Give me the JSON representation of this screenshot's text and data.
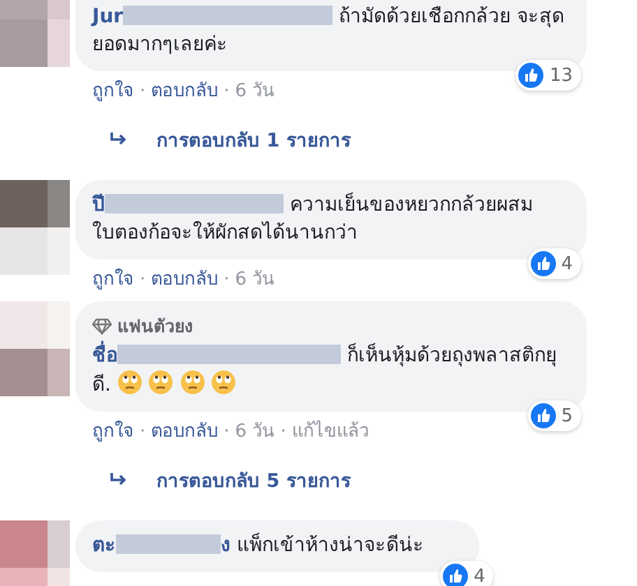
{
  "comments": [
    {
      "author": "Jur",
      "text": "ถ้ามัดด้วยเชือกกล้วย จะสุดยอดมากๆเลยค่ะ",
      "reactions": "13",
      "actions": [
        {
          "kind": "link",
          "text": "ถูกใจ"
        },
        {
          "kind": "sep",
          "text": "·"
        },
        {
          "kind": "link",
          "text": "ตอบกลับ"
        },
        {
          "kind": "sep",
          "text": "·"
        },
        {
          "kind": "meta",
          "text": "6 วัน"
        }
      ],
      "replies": "การตอบกลับ 1 รายการ"
    },
    {
      "author": "ปี",
      "text": "ความเย็นของหยวกกล้วยผสมใบตองก้อจะให้ผักสดได้นานกว่า",
      "reactions": "4",
      "actions": [
        {
          "kind": "link",
          "text": "ถูกใจ"
        },
        {
          "kind": "sep",
          "text": "·"
        },
        {
          "kind": "link",
          "text": "ตอบกลับ"
        },
        {
          "kind": "sep",
          "text": "·"
        },
        {
          "kind": "meta",
          "text": "6 วัน"
        }
      ]
    },
    {
      "badge": "แฟนตัวยง",
      "author": "ชื่อ",
      "text": "ก็เห็นหุ้มด้วยถุงพลาสติกยุดี.",
      "emojis": [
        {
          "kind": "eye-roll"
        },
        {
          "kind": "eye-roll"
        },
        {
          "kind": "eye-roll"
        },
        {
          "kind": "eye-roll"
        }
      ],
      "reactions": "5",
      "actions": [
        {
          "kind": "link",
          "text": "ถูกใจ"
        },
        {
          "kind": "sep",
          "text": "·"
        },
        {
          "kind": "link",
          "text": "ตอบกลับ"
        },
        {
          "kind": "sep",
          "text": "·"
        },
        {
          "kind": "meta",
          "text": "6 วัน"
        },
        {
          "kind": "sep",
          "text": "·"
        },
        {
          "kind": "meta",
          "text": "แก้ไขแล้ว"
        }
      ],
      "replies": "การตอบกลับ 5 รายการ"
    },
    {
      "author": "ตะ",
      "author_tail": "ง",
      "text": "แพ็กเข้าห้างน่าจะดีน่ะ",
      "reactions": "4"
    }
  ]
}
